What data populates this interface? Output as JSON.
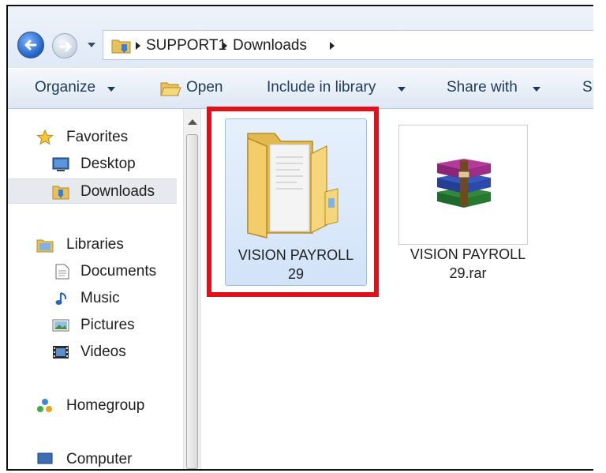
{
  "breadcrumb": {
    "items": [
      "SUPPORT1",
      "Downloads"
    ]
  },
  "toolbar": {
    "organize": "Organize",
    "open": "Open",
    "include_in_library": "Include in library",
    "share_with": "Share with",
    "overflow": "Sl"
  },
  "nav": {
    "favorites": "Favorites",
    "desktop": "Desktop",
    "downloads": "Downloads",
    "libraries": "Libraries",
    "documents": "Documents",
    "music": "Music",
    "pictures": "Pictures",
    "videos": "Videos",
    "homegroup": "Homegroup",
    "computer": "Computer",
    "selected_item": "Downloads"
  },
  "files": [
    {
      "name_line1": "VISION PAYROLL",
      "name_line2": "29",
      "type": "folder",
      "selected": true
    },
    {
      "name_line1": "VISION PAYROLL",
      "name_line2": "29.rar",
      "type": "rar-archive",
      "selected": false
    }
  ],
  "colors": {
    "highlight": "#e2101a",
    "selection": "#d2e3f8",
    "toolbar_text": "#1e395b"
  },
  "icons": {
    "back": "back-arrow-icon",
    "forward": "forward-arrow-icon",
    "folder": "folder-icon",
    "archive": "winrar-archive-icon"
  }
}
